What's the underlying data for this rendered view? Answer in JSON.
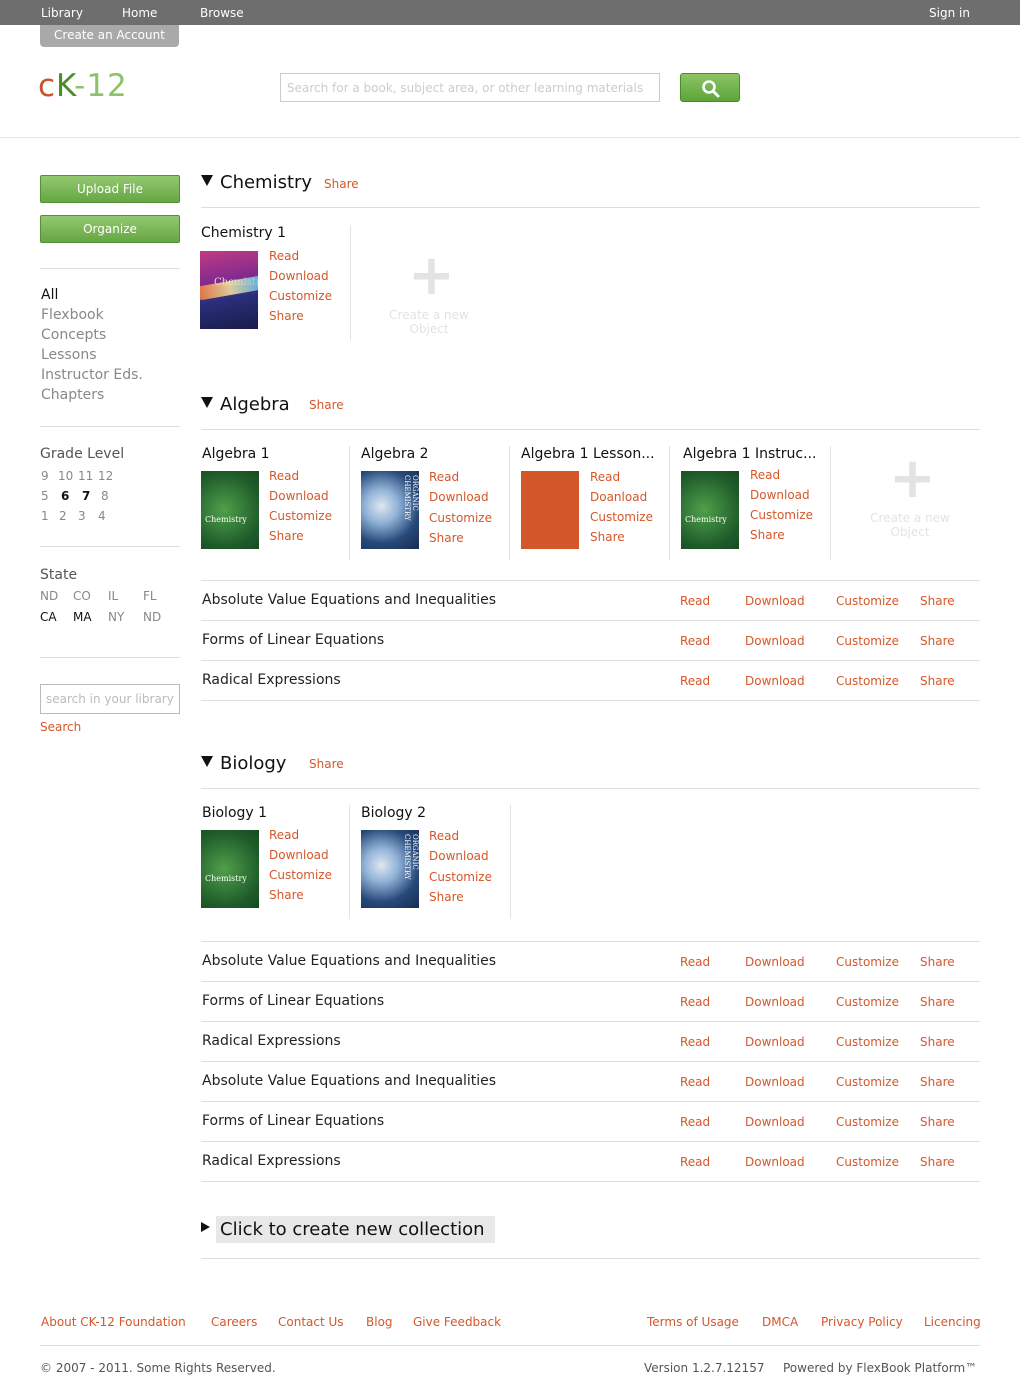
{
  "topnav": {
    "library": "Library",
    "home": "Home",
    "browse": "Browse",
    "signin": "Sign in",
    "create_account": "Create an Account"
  },
  "logo": {
    "c": "c",
    "k": "K",
    "dash": "-",
    "num": "12"
  },
  "search": {
    "placeholder": "Search for a book, subject area, or other learning materials"
  },
  "sidebar": {
    "upload": "Upload File",
    "organize": "Organize",
    "filters": [
      "All",
      "Flexbook",
      "Concepts",
      "Lessons",
      "Instructor Eds.",
      "Chapters"
    ],
    "grade_label": "Grade Level",
    "grades": [
      [
        "9",
        "10",
        "11",
        "12"
      ],
      [
        "5",
        "6",
        "7",
        "8"
      ],
      [
        "1",
        "2",
        "3",
        "4"
      ]
    ],
    "state_label": "State",
    "states": [
      [
        "ND",
        "CO",
        "IL",
        "FL"
      ],
      [
        "CA",
        "MA",
        "NY",
        "ND"
      ]
    ],
    "lib_search_placeholder": "search in your library",
    "lib_search_link": "Search"
  },
  "actions": {
    "read": "Read",
    "download": "Download",
    "doanload": "Doanload",
    "customize": "Customize",
    "share": "Share"
  },
  "new_object": "Create a new Object",
  "sections": {
    "chemistry": {
      "title": "Chemistry",
      "share": "Share",
      "books": [
        "Chemistry 1"
      ]
    },
    "algebra": {
      "title": "Algebra",
      "share": "Share",
      "books": [
        "Algebra 1",
        "Algebra 2",
        "Algebra 1 Lesson...",
        "Algebra 1 Instruc..."
      ],
      "rows": [
        "Absolute Value Equations and Inequalities",
        "Forms of Linear Equations",
        "Radical Expressions"
      ]
    },
    "biology": {
      "title": "Biology",
      "share": "Share",
      "books": [
        "Biology 1",
        "Biology 2"
      ],
      "rows": [
        "Absolute Value Equations and Inequalities",
        "Forms of Linear Equations",
        "Radical Expressions",
        "Absolute Value Equations and Inequalities",
        "Forms of Linear Equations",
        "Radical Expressions"
      ]
    }
  },
  "covers": {
    "chemistry": "Chemistry",
    "orgchem": "ORGANIC CHEMISTRY"
  },
  "new_collection": "Click to create new collection",
  "footer": {
    "links_left": [
      "About CK-12 Foundation",
      "Careers",
      "Contact Us",
      "Blog",
      "Give Feedback"
    ],
    "links_right": [
      "Terms of Usage",
      "DMCA",
      "Privacy Policy",
      "Licencing"
    ],
    "copyright": "© 2007 - 2011. Some Rights Reserved.",
    "version": "Version 1.2.7.12157",
    "powered": "Powered by FlexBook Platform™"
  },
  "colors": {
    "accent": "#d4572a",
    "green": "#66a643",
    "topbar": "#6e6e6e"
  }
}
